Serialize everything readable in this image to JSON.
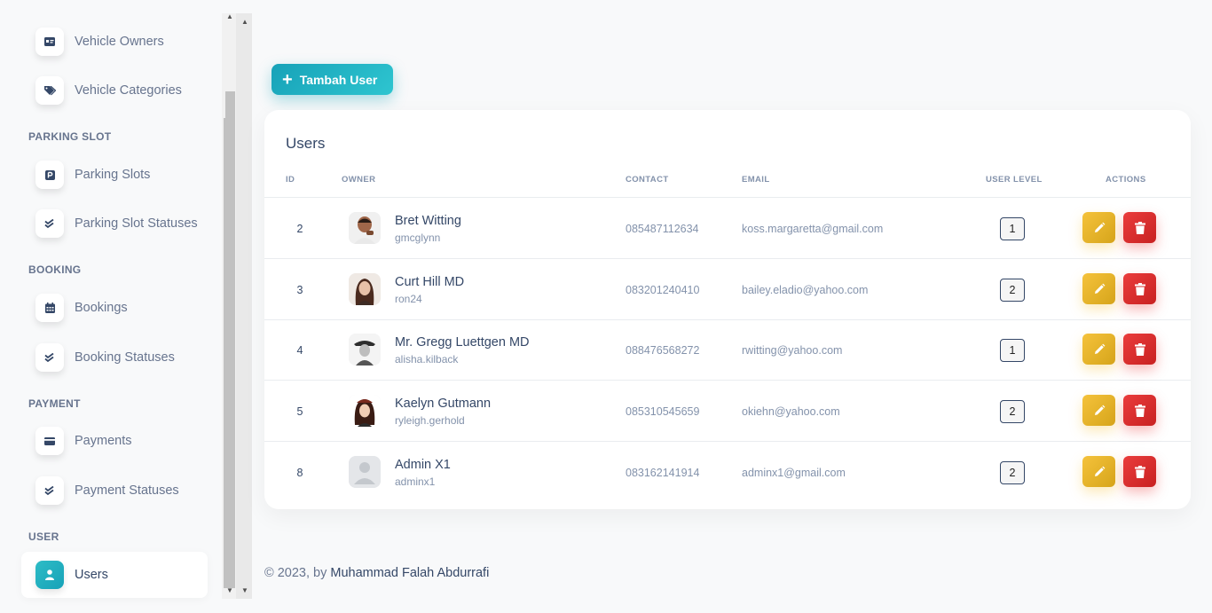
{
  "sidebar": {
    "items_top": [
      {
        "label": "Vehicle Owners",
        "icon": "id-card-icon"
      },
      {
        "label": "Vehicle Categories",
        "icon": "tags-icon"
      }
    ],
    "sections": [
      {
        "title": "PARKING SLOT",
        "items": [
          {
            "label": "Parking Slots",
            "icon": "parking-icon"
          },
          {
            "label": "Parking Slot Statuses",
            "icon": "check-double-icon"
          }
        ]
      },
      {
        "title": "BOOKING",
        "items": [
          {
            "label": "Bookings",
            "icon": "calendar-icon"
          },
          {
            "label": "Booking Statuses",
            "icon": "check-double-icon"
          }
        ]
      },
      {
        "title": "PAYMENT",
        "items": [
          {
            "label": "Payments",
            "icon": "credit-card-icon"
          },
          {
            "label": "Payment Statuses",
            "icon": "check-double-icon"
          }
        ]
      },
      {
        "title": "USER",
        "items": [
          {
            "label": "Users",
            "icon": "user-icon",
            "active": true
          }
        ]
      }
    ]
  },
  "toolbar": {
    "add_label": "Tambah User",
    "add_icon": "plus-icon"
  },
  "table": {
    "title": "Users",
    "columns": {
      "id": "ID",
      "owner": "OWNER",
      "contact": "CONTACT",
      "email": "EMAIL",
      "level": "USER LEVEL",
      "actions": "ACTIONS"
    },
    "rows": [
      {
        "id": "2",
        "name": "Bret Witting",
        "username": "gmcglynn",
        "contact": "085487112634",
        "email": "koss.margaretta@gmail.com",
        "level": "1",
        "avatar": "man-avatar"
      },
      {
        "id": "3",
        "name": "Curt Hill MD",
        "username": "ron24",
        "contact": "083201240410",
        "email": "bailey.eladio@yahoo.com",
        "level": "2",
        "avatar": "woman-avatar"
      },
      {
        "id": "4",
        "name": "Mr. Gregg Luettgen MD",
        "username": "alisha.kilback",
        "contact": "088476568272",
        "email": "rwitting@yahoo.com",
        "level": "1",
        "avatar": "man-hat-avatar"
      },
      {
        "id": "5",
        "name": "Kaelyn Gutmann",
        "username": "ryleigh.gerhold",
        "contact": "085310545659",
        "email": "okiehn@yahoo.com",
        "level": "2",
        "avatar": "woman-dark-hair-avatar"
      },
      {
        "id": "8",
        "name": "Admin X1",
        "username": "adminx1",
        "contact": "083162141914",
        "email": "adminx1@gmail.com",
        "level": "2",
        "avatar": "default-avatar"
      }
    ]
  },
  "footer": {
    "prefix": "© 2023, by ",
    "author": "Muhammad Falah Abdurrafi"
  },
  "colors": {
    "accent": "#17a2b8",
    "edit": "#f5c23b",
    "delete": "#ea3c3c",
    "text": "#344767",
    "muted": "#8392ab"
  }
}
